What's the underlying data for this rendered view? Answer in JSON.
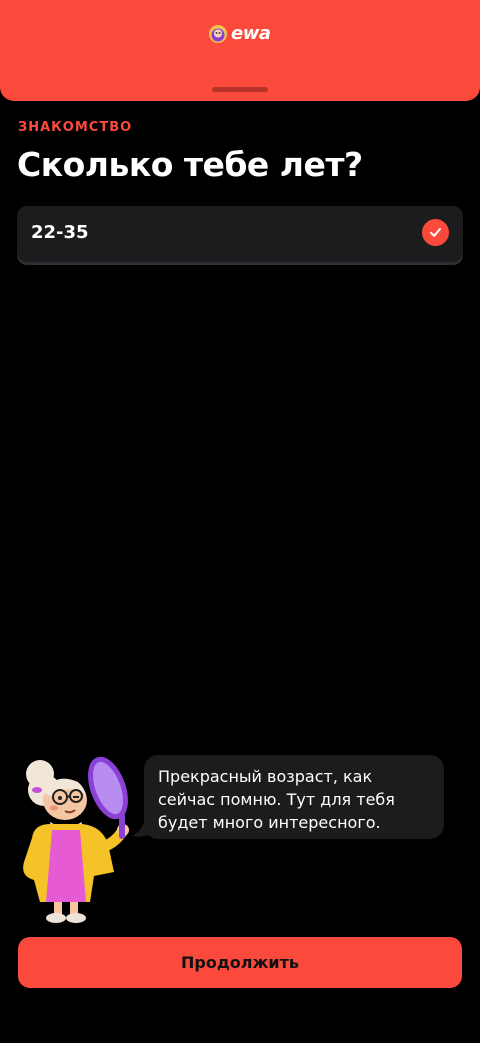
{
  "header": {
    "logo_text": "ewa",
    "logo_icon": "ewa-mascot-logo-icon",
    "handle_icon": "drag-handle",
    "background_color": "#fb4a3c"
  },
  "step": {
    "eyebrow": "ЗНАКОМСТВО",
    "title": "Сколько тебе лет?"
  },
  "answer": {
    "value": "22-35",
    "selected": true,
    "status_icon": "check-icon"
  },
  "assistant": {
    "avatar": "grandma-magnifier-illustration",
    "message_lines": [
      "Прекрасный возраст, как",
      "сейчас помню. Тут для тебя",
      "будет много интересного."
    ]
  },
  "footer": {
    "continue_label": "Продолжить"
  },
  "colors": {
    "accent": "#fb4a3c",
    "background": "#000000",
    "card": "#1c1c1e",
    "text": "#ffffff"
  }
}
